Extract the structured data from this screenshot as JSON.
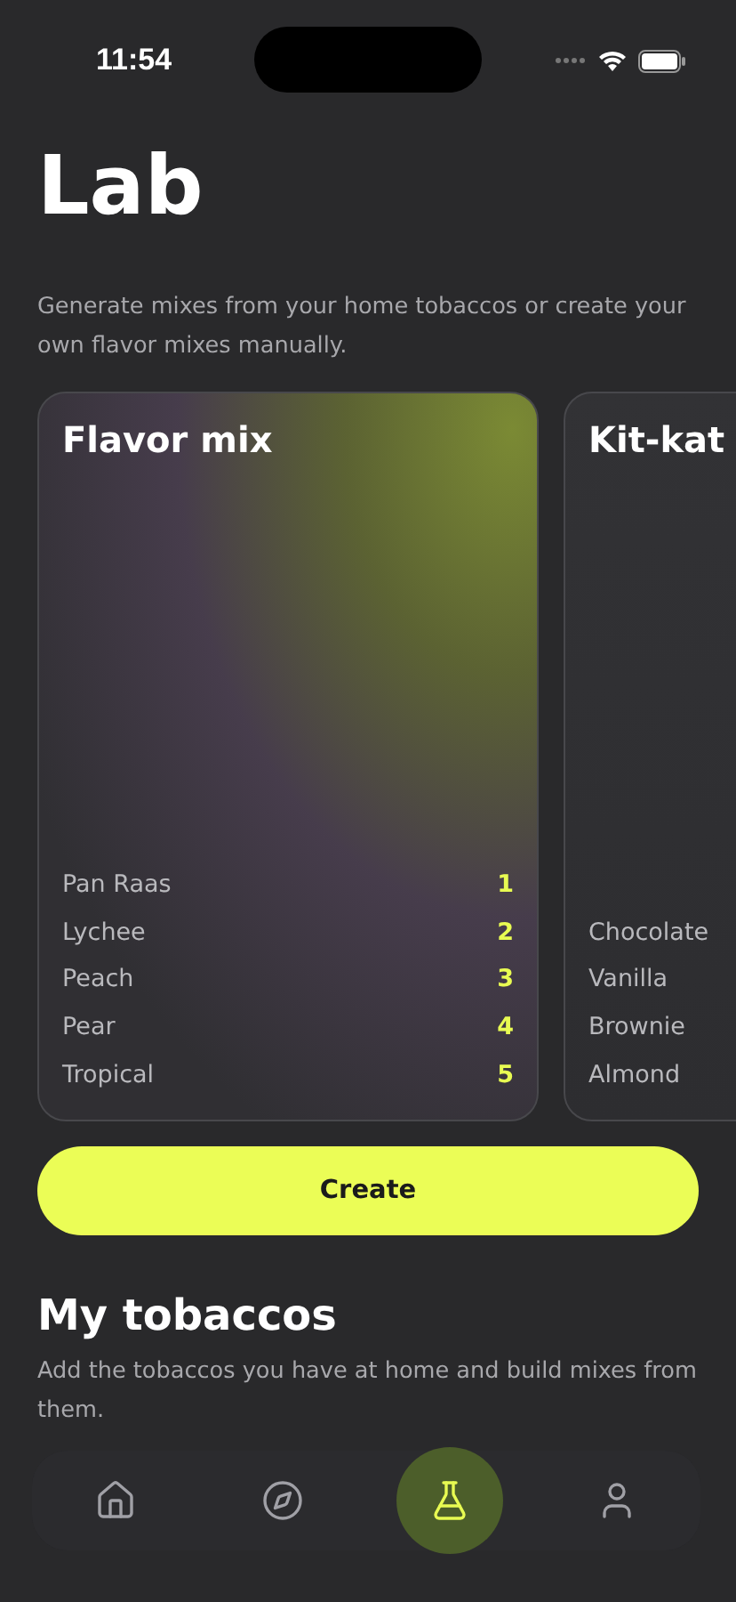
{
  "status_bar": {
    "time": "11:54"
  },
  "header": {
    "title": "Lab",
    "description": "Generate mixes from your home tobaccos or create your own flavor mixes manually."
  },
  "mixes": [
    {
      "title": "Flavor mix",
      "glow": true,
      "ingredients": [
        {
          "name": "Pan Raas",
          "rank": "1"
        },
        {
          "name": "Lychee",
          "rank": "2"
        },
        {
          "name": "Peach",
          "rank": "3"
        },
        {
          "name": "Pear",
          "rank": "4"
        },
        {
          "name": "Tropical",
          "rank": "5"
        }
      ]
    },
    {
      "title": "Kit-kat",
      "glow": false,
      "ingredients": [
        {
          "name": "Chocolate"
        },
        {
          "name": "Vanilla"
        },
        {
          "name": "Brownie"
        },
        {
          "name": "Almond"
        }
      ]
    }
  ],
  "create_button": {
    "label": "Create"
  },
  "my_tobaccos": {
    "title": "My tobaccos",
    "description": "Add the tobaccos you have at home and build mixes from them."
  },
  "tab_bar": [
    {
      "kind": "home",
      "selected": false
    },
    {
      "kind": "explore",
      "selected": false
    },
    {
      "kind": "lab",
      "selected": true
    },
    {
      "kind": "profile",
      "selected": false
    }
  ]
}
